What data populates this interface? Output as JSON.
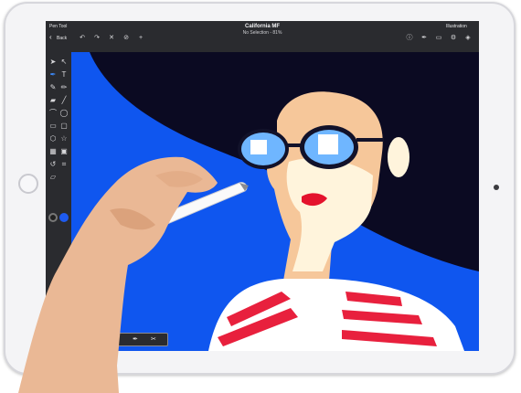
{
  "topbar": {
    "app_name": "Pen Tool",
    "back_label": "Back",
    "document_title": "California MF",
    "selection_status": "No Selection - 81%",
    "mode_label": "Illustration",
    "left_icons": [
      "undo-icon",
      "redo-icon",
      "close-icon",
      "link-icon",
      "plus-icon"
    ],
    "right_icons": [
      "info-icon",
      "pen-icon",
      "document-icon",
      "gear-icon",
      "layers-icon"
    ]
  },
  "left_toolbar": {
    "tools": [
      "select-arrow-icon",
      "direct-select-arrow-icon",
      "pen-tool-icon",
      "text-tool-icon",
      "brush-tool-icon",
      "pencil-tool-icon",
      "eraser-tool-icon",
      "line-tool-icon",
      "curve-tool-icon",
      "ellipse-tool-icon",
      "rectangle-tool-icon",
      "rounded-rectangle-tool-icon",
      "polygon-tool-icon",
      "star-tool-icon",
      "grid-tool-icon",
      "image-tool-icon",
      "lasso-tool-icon",
      "crop-tool-icon",
      "shear-tool-icon"
    ],
    "stroke_color": "#222222",
    "fill_color": "#1e5bf0"
  },
  "colors": {
    "canvas_blue": "#0f56ef",
    "hair": "#0b0a22",
    "skin": "#f6c79a",
    "face_light": "#fff4dc",
    "lips": "#e4122d",
    "stripe_red": "#e8203d",
    "stripe_white": "#ffffff"
  },
  "mini_toolbar": {
    "icons": [
      "color-picker-icon",
      "pen-small-icon",
      "scissors-icon"
    ]
  }
}
